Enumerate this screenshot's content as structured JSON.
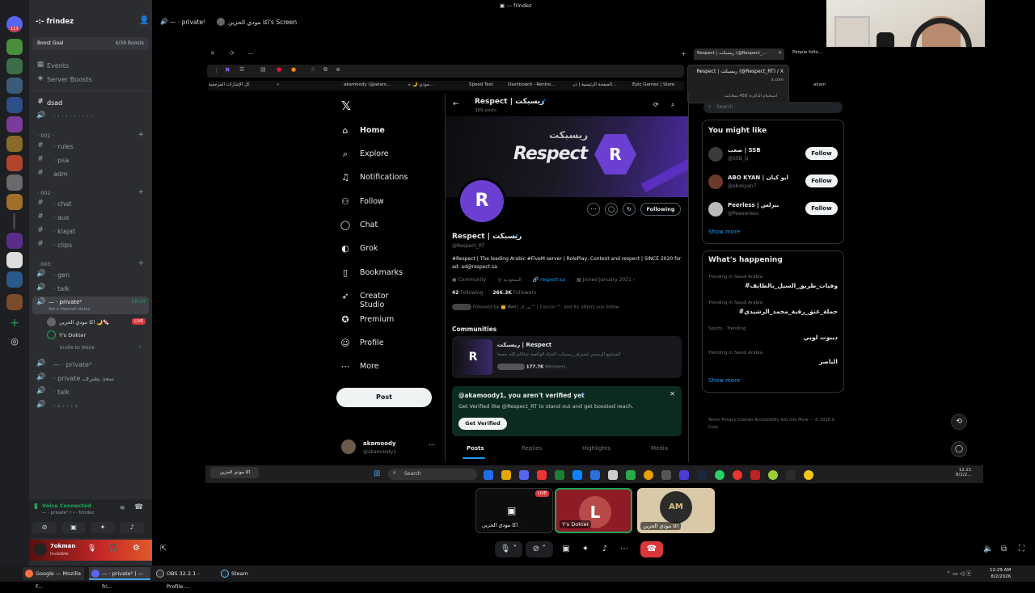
{
  "window_title": "-:- frindez",
  "servers": {
    "badge": "113"
  },
  "channel_panel": {
    "server_name": "-:- frindez",
    "boost_goal_label": "Boost Goal",
    "boost_goal_count": "4/39 Boosts",
    "events": "Events",
    "server_boosts": "Server Boosts",
    "category_dsad": "dsad",
    "dots_channel": "· · · · · · · · · ·",
    "cat_001": "· 001 ·",
    "ch_rules": "· rules",
    "ch_psa": "· psa",
    "ch_adm": "adm",
    "cat_002": "· 002 ·",
    "ch_chat": "· chat",
    "ch_aux": "· aux",
    "ch_klajat": "· klajat",
    "ch_clips": "· clips",
    "cat_003": "· 003 ·",
    "ch_gen": "· gen",
    "ch_talk": "· talk",
    "voice_private": "— · private²",
    "voice_private_time": "56:24",
    "voice_status": "Set a channel status",
    "member1": "اكا مودي الحزين 🌙🍬",
    "member1_badge": "LIVE",
    "member2": "Y's Dokter",
    "invite": "Invite to Voice",
    "voice_private2": "— · private³",
    "voice_private_ar": "· private سعد يشرف",
    "voice_talk2": "· talk",
    "voice_misc": "· ‹ -  · - ›"
  },
  "voice_connected": {
    "status": "Voice Connected",
    "channel": "— · private² / -:- frindez"
  },
  "user": {
    "name": "7okman",
    "status": "Invisible"
  },
  "stage_header": {
    "channel": "— · private²",
    "screen_title": "اكا مودي الحزين's Screen"
  },
  "browser": {
    "tabs": [
      {
        "label": "Respect | ريسبكت (@Respect_..."
      },
      {
        "label": "People follo..."
      }
    ],
    "tab_tooltip_title": "Respect | ريسبكت (@Respect_RT) / X",
    "tab_tooltip_domain": "x.com",
    "tab_tooltip_memory": "استخدام الذاكرة: 458 ميغابايت",
    "bookmarks": [
      "كل الإشارات المرجعية",
      "akamoody (@akam...",
      "مودي 🌙 ه...",
      "Speed Test",
      "Dashboard - Rentre...",
      "الصفحة الرئيسية | ديـ...",
      "Epic Games | Store",
      "akam"
    ]
  },
  "x_nav": {
    "items": [
      "Home",
      "Explore",
      "Notifications",
      "Follow",
      "Chat",
      "Grok",
      "Bookmarks",
      "Creator Studio",
      "Premium",
      "Profile",
      "More"
    ],
    "post_button": "Post",
    "account_name": "akamoody",
    "account_handle": "@akamoody1"
  },
  "profile": {
    "header_name": "Respect | ريسبكت",
    "header_posts": "389 posts",
    "banner_text": "Respect",
    "banner_text_ar": "ريسبكت",
    "following_button": "Following",
    "name": "Respect | ريسبكت",
    "handle": "@Respect_RT",
    "bio": "#Respect | The leading Arabic #FiveM server | RolePlay, Content and respect | SINCE 2020 for ad: ad@respect.sa",
    "category": "Community",
    "location": "السعودية",
    "website": "respect.sa",
    "joined": "Joined January 2021",
    "following_count": "42",
    "following_label": "Following",
    "followers_count": "266.3K",
    "followers_label": "Followers",
    "followed_by": "Followed by 👑 𝕹𝖆𝖎𝖋 | بيـ, الـ™ | 𝔽𝕒𝕪𝕤𝕒𝕝 ™, and 61 others you follow",
    "communities_title": "Communities",
    "community_name": "ريسبكت | Respect",
    "community_desc": "المجتمع الرسمي لسيرفر ريسبكت الحياة الواقعية خيالكم الله جميعا",
    "community_members": "177.7K",
    "community_members_label": "Members",
    "verify_title": "@akamoody1, you aren't verified yet",
    "verify_text": "Get Verified like @Respect_RT to stand out and get boosted reach.",
    "verify_button": "Get Verified",
    "tabs": [
      "Posts",
      "Replies",
      "Highlights",
      "Media"
    ]
  },
  "sidebar_right": {
    "search_placeholder": "Search",
    "you_might_like": "You might like",
    "suggestions": [
      {
        "name": "صعب | SSB",
        "handle": "@SSB_Q",
        "button": "Follow"
      },
      {
        "name": "ABO KYAN | ابو كيان",
        "handle": "@abokyan7",
        "button": "Follow"
      },
      {
        "name": "Peerless | بيرلس",
        "handle": "@Peeeerless",
        "button": "Follow"
      }
    ],
    "show_more": "Show more",
    "whats_happening": "What's happening",
    "trends": [
      {
        "context": "Trending in Saudi Arabia",
        "name": "#وفيات_طريق_السيل_بالطايف"
      },
      {
        "context": "Trending in Saudi Arabia",
        "name": "#حملة_عتق_رقبة_محمد_الرشيدي"
      },
      {
        "context": "Sports · Trending",
        "name": "ديبوت لوبي"
      },
      {
        "context": "Trending in Saudi Arabia",
        "name": "الناصر"
      }
    ],
    "show_more2": "Show more",
    "footer": "Terms   Privacy   Cookies   Accessibility   Ads info   More ···   © 2026 X Corp."
  },
  "inner_taskbar": {
    "app_label": "اكا مودي الحزين",
    "search": "Search",
    "time": "12:21",
    "date": "8/2/2..."
  },
  "tiles": [
    {
      "label": "اكا مودي الحزين",
      "badge": "LIVE"
    },
    {
      "label": "Y's Dokter"
    },
    {
      "label": "اكا مودي الحزين"
    }
  ],
  "win_taskbar": {
    "items": [
      "Google — Mozilla F...",
      "— · private² | -:- fri...",
      "OBS 32.2.1 - Profile:...",
      "Steam"
    ],
    "time": "12:29 AM",
    "date": "8/2/2026"
  },
  "colors": {
    "discord_bg": "#2b2d31",
    "accent_green": "#23a55a",
    "live_red": "#da373c",
    "x_blue": "#1d9bf0",
    "respect_purple": "#6b3fd1"
  }
}
